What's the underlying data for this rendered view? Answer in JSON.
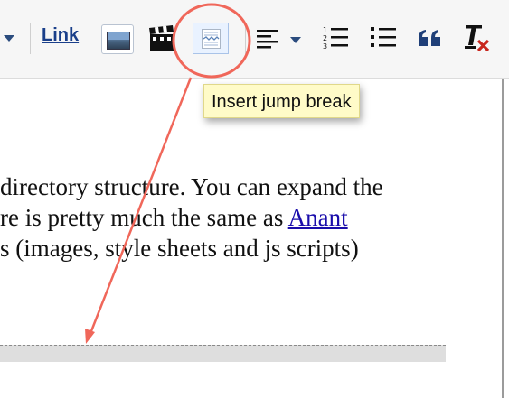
{
  "toolbar": {
    "link_label": "Link",
    "buttons": [
      {
        "name": "dropdown-caret",
        "icon": "chevron-down-icon"
      },
      {
        "name": "link-button",
        "icon": "link"
      },
      {
        "name": "insert-image-button",
        "icon": "image-icon"
      },
      {
        "name": "insert-video-button",
        "icon": "clapperboard-icon"
      },
      {
        "name": "insert-jump-break-button",
        "icon": "jump-break-icon"
      },
      {
        "name": "alignment-button",
        "icon": "align-left-icon"
      },
      {
        "name": "numbered-list-button",
        "icon": "numbered-list-icon"
      },
      {
        "name": "bulleted-list-button",
        "icon": "bulleted-list-icon"
      },
      {
        "name": "quote-button",
        "icon": "quote-icon"
      },
      {
        "name": "remove-formatting-button",
        "icon": "remove-formatting-icon"
      }
    ]
  },
  "tooltip": {
    "text": "Insert jump break"
  },
  "editor": {
    "lines": [
      "directory structure. You can expand the",
      "re is pretty much the same as ",
      "s (images, style sheets and js scripts)"
    ],
    "link_text": "Anant "
  },
  "annotation": {
    "color": "#f0675a"
  }
}
